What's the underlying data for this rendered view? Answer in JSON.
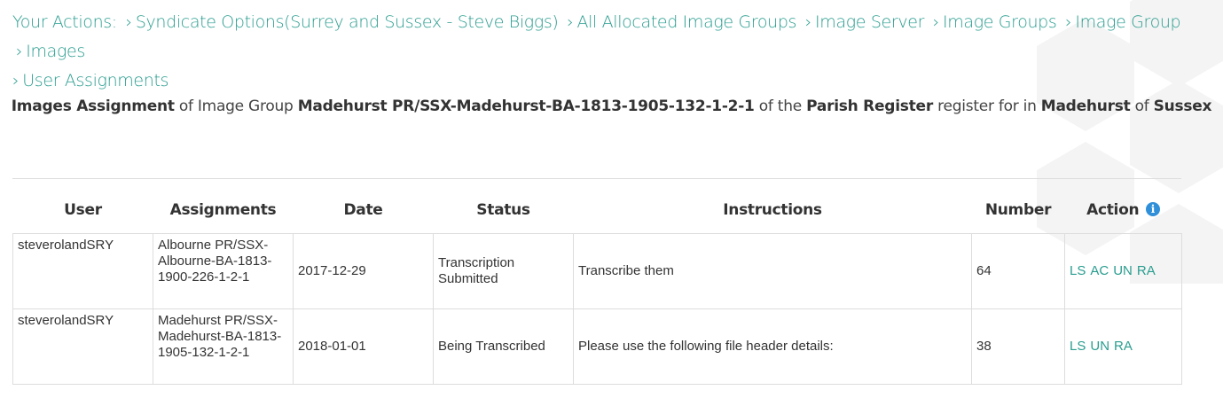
{
  "breadcrumb": {
    "prefix": "Your Actions:",
    "items": [
      "Syndicate Options(Surrey and Sussex - Steve Biggs)",
      "All Allocated Image Groups",
      "Image Server",
      "Image Groups",
      "Image Group",
      "Images",
      "User Assignments"
    ]
  },
  "heading": {
    "part1": "Images Assignment",
    "part2": "of Image Group",
    "group": "Madehurst PR/SSX-Madehurst-BA-1813-1905-132-1-2-1",
    "part3": "of the",
    "register": "Parish Register",
    "part4": "register for in",
    "place": "Madehurst",
    "part5": "of",
    "county": "Sussex"
  },
  "table": {
    "headers": [
      "User",
      "Assignments",
      "Date",
      "Status",
      "Instructions",
      "Number",
      "Action"
    ],
    "rows": [
      {
        "user": "steverolandSRY",
        "assignment": "Albourne PR/SSX-Albourne-BA-1813-1900-226-1-2-1",
        "date": "2017-12-29",
        "status": "Transcription Submitted",
        "instructions": "Transcribe them",
        "number": "64",
        "actions": [
          "LS",
          "AC",
          "UN",
          "RA"
        ]
      },
      {
        "user": "steverolandSRY",
        "assignment": "Madehurst PR/SSX-Madehurst-BA-1813-1905-132-1-2-1",
        "date": "2018-01-01",
        "status": "Being Transcribed",
        "instructions": "Please use the following file header details:",
        "number": "38",
        "actions": [
          "LS",
          "UN",
          "RA"
        ]
      }
    ]
  },
  "colors": {
    "link": "#2a9d8f",
    "info": "#2f8fd8",
    "border": "#dddddd"
  },
  "icons": {
    "action_info": "info-icon"
  }
}
